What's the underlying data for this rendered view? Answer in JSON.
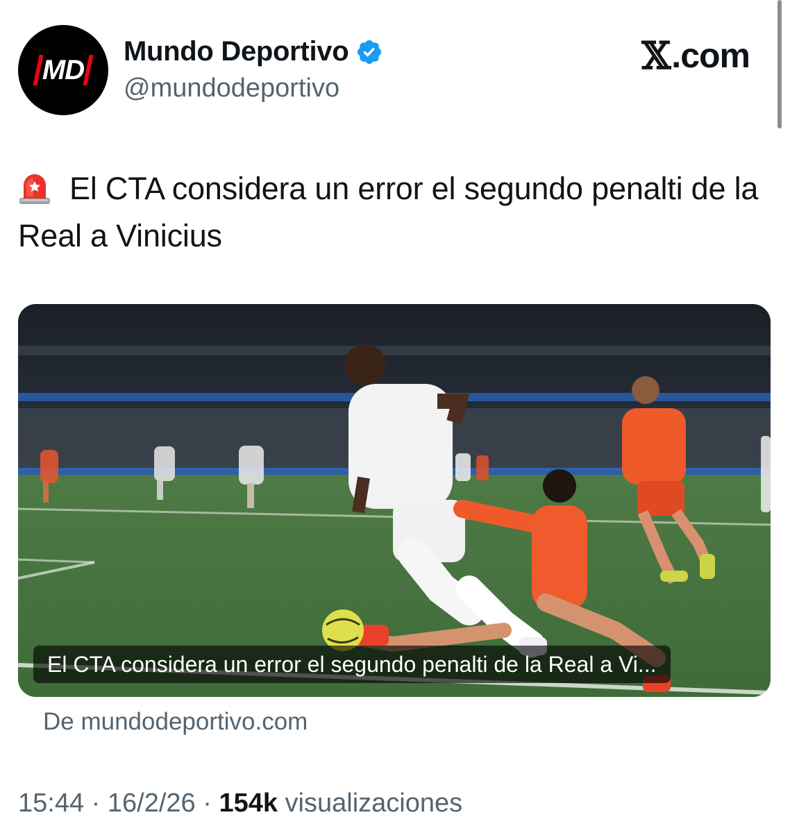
{
  "account": {
    "display_name": "Mundo Deportivo",
    "handle": "@mundodeportivo",
    "avatar_logo_text": "MD",
    "verified": true
  },
  "brand": {
    "x_glyph": "𝕏",
    "domain": ".com"
  },
  "tweet": {
    "emoji": "siren-icon",
    "text": "El CTA considera un error el segundo penalti de la Real a Vinicius"
  },
  "media": {
    "caption": "El CTA considera un error el segundo penalti de la Real a Vi...",
    "source": "De mundodeportivo.com"
  },
  "meta": {
    "time": "15:44",
    "separator": " · ",
    "date": "16/2/26",
    "views_count": "154k",
    "views_label": " visualizaciones"
  },
  "colors": {
    "text_primary": "#0f1419",
    "text_secondary": "#536471",
    "verified_blue": "#1d9bf0",
    "md_red": "#e30613"
  }
}
